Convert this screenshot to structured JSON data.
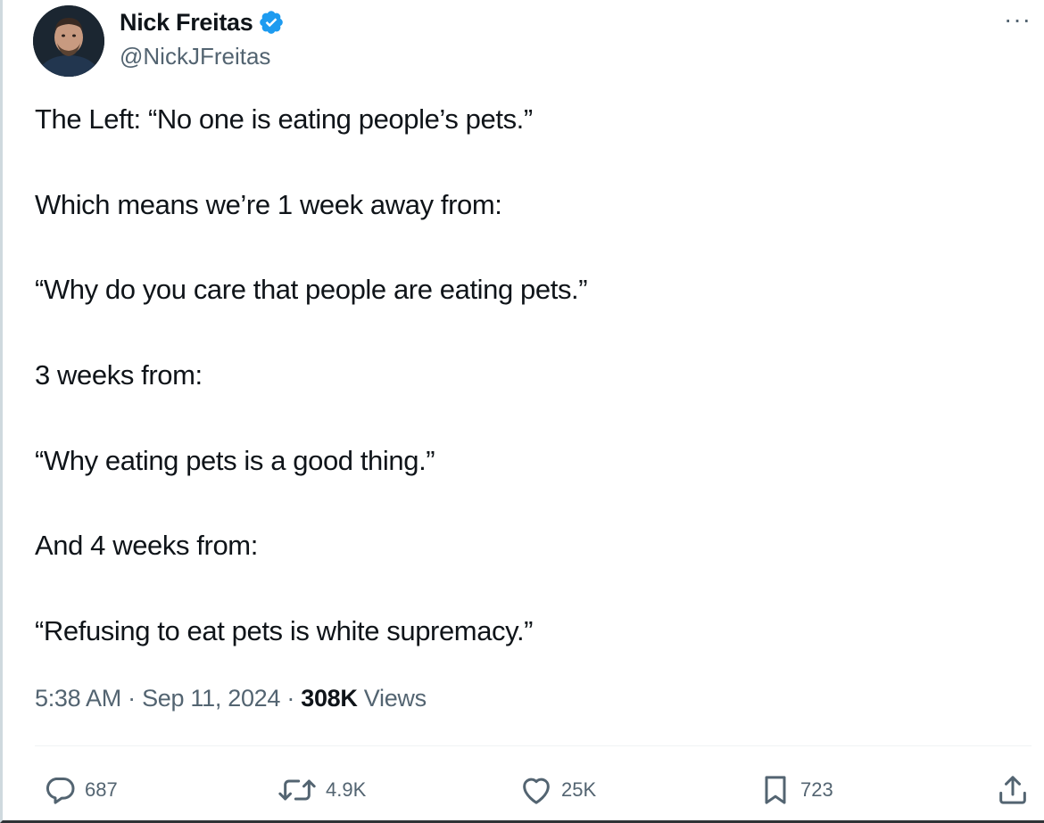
{
  "author": {
    "display_name": "Nick Freitas",
    "handle": "@NickJFreitas",
    "verified_icon": "verified-badge-icon",
    "verified_color": "#1d9bf0"
  },
  "menu": {
    "more_label": "···"
  },
  "tweet": {
    "lines": [
      "The Left: “No one is eating people’s pets.”",
      "Which means we’re  1 week away from:",
      "“Why do you care that people are eating pets.”",
      "3 weeks from:",
      "“Why eating pets is a good thing.”",
      "And 4 weeks from:",
      "“Refusing to eat pets is white supremacy.”"
    ]
  },
  "meta": {
    "time": "5:38 AM",
    "separator": "·",
    "date": "Sep 11, 2024",
    "views_count": "308K",
    "views_label": "Views"
  },
  "actions": {
    "replies": "687",
    "reposts": "4.9K",
    "likes": "25K",
    "bookmarks": "723"
  },
  "colors": {
    "text": "#0f1419",
    "secondary": "#536471",
    "accent": "#1d9bf0"
  }
}
